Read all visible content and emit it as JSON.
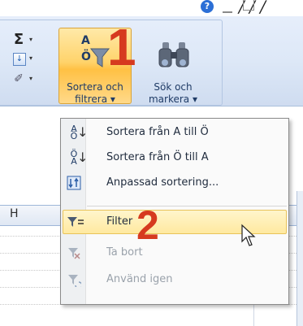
{
  "title_fragment": "∕ ∕ ∕",
  "window": {
    "help_glyph": "?"
  },
  "ribbon": {
    "small_buttons": [
      {
        "icon": "sigma-icon",
        "glyph": "Σ"
      },
      {
        "icon": "fill-down-icon",
        "glyph": "↓"
      },
      {
        "icon": "eraser-icon",
        "glyph": "✐"
      }
    ],
    "dropdown_arrow": "▾",
    "sort_filter": {
      "label_line1": "Sortera och",
      "label_line2": "filtrera ▾",
      "icon": "sort-az-filter-icon"
    },
    "find_select": {
      "label_line1": "Sök och",
      "label_line2": "markera ▾",
      "icon": "binoculars-icon"
    }
  },
  "annotations": {
    "step1": "1",
    "step2": "2",
    "color": "#d63a1f"
  },
  "sheet": {
    "column_header": "H"
  },
  "menu": {
    "items": [
      {
        "label": "Sortera från A till Ö",
        "icon": "sort-ascending-icon",
        "glyph_top": "A",
        "glyph_bottom": "Ö",
        "enabled": true
      },
      {
        "label": "Sortera från Ö till A",
        "icon": "sort-descending-icon",
        "glyph_top": "Ö",
        "glyph_bottom": "A",
        "enabled": true
      },
      {
        "label": "Anpassad sortering...",
        "icon": "custom-sort-icon",
        "enabled": true
      },
      {
        "label": "Filter",
        "icon": "filter-icon",
        "enabled": true,
        "highlighted": true
      },
      {
        "label": "Ta bort",
        "icon": "clear-filter-icon",
        "enabled": false
      },
      {
        "label": "Använd igen",
        "icon": "reapply-icon",
        "enabled": false
      }
    ]
  },
  "colors": {
    "ribbon_bg": "#dde8f7",
    "active_button": "#ffd36b",
    "menu_highlight": "#ffe9a0",
    "text_blue": "#1f3b66"
  }
}
